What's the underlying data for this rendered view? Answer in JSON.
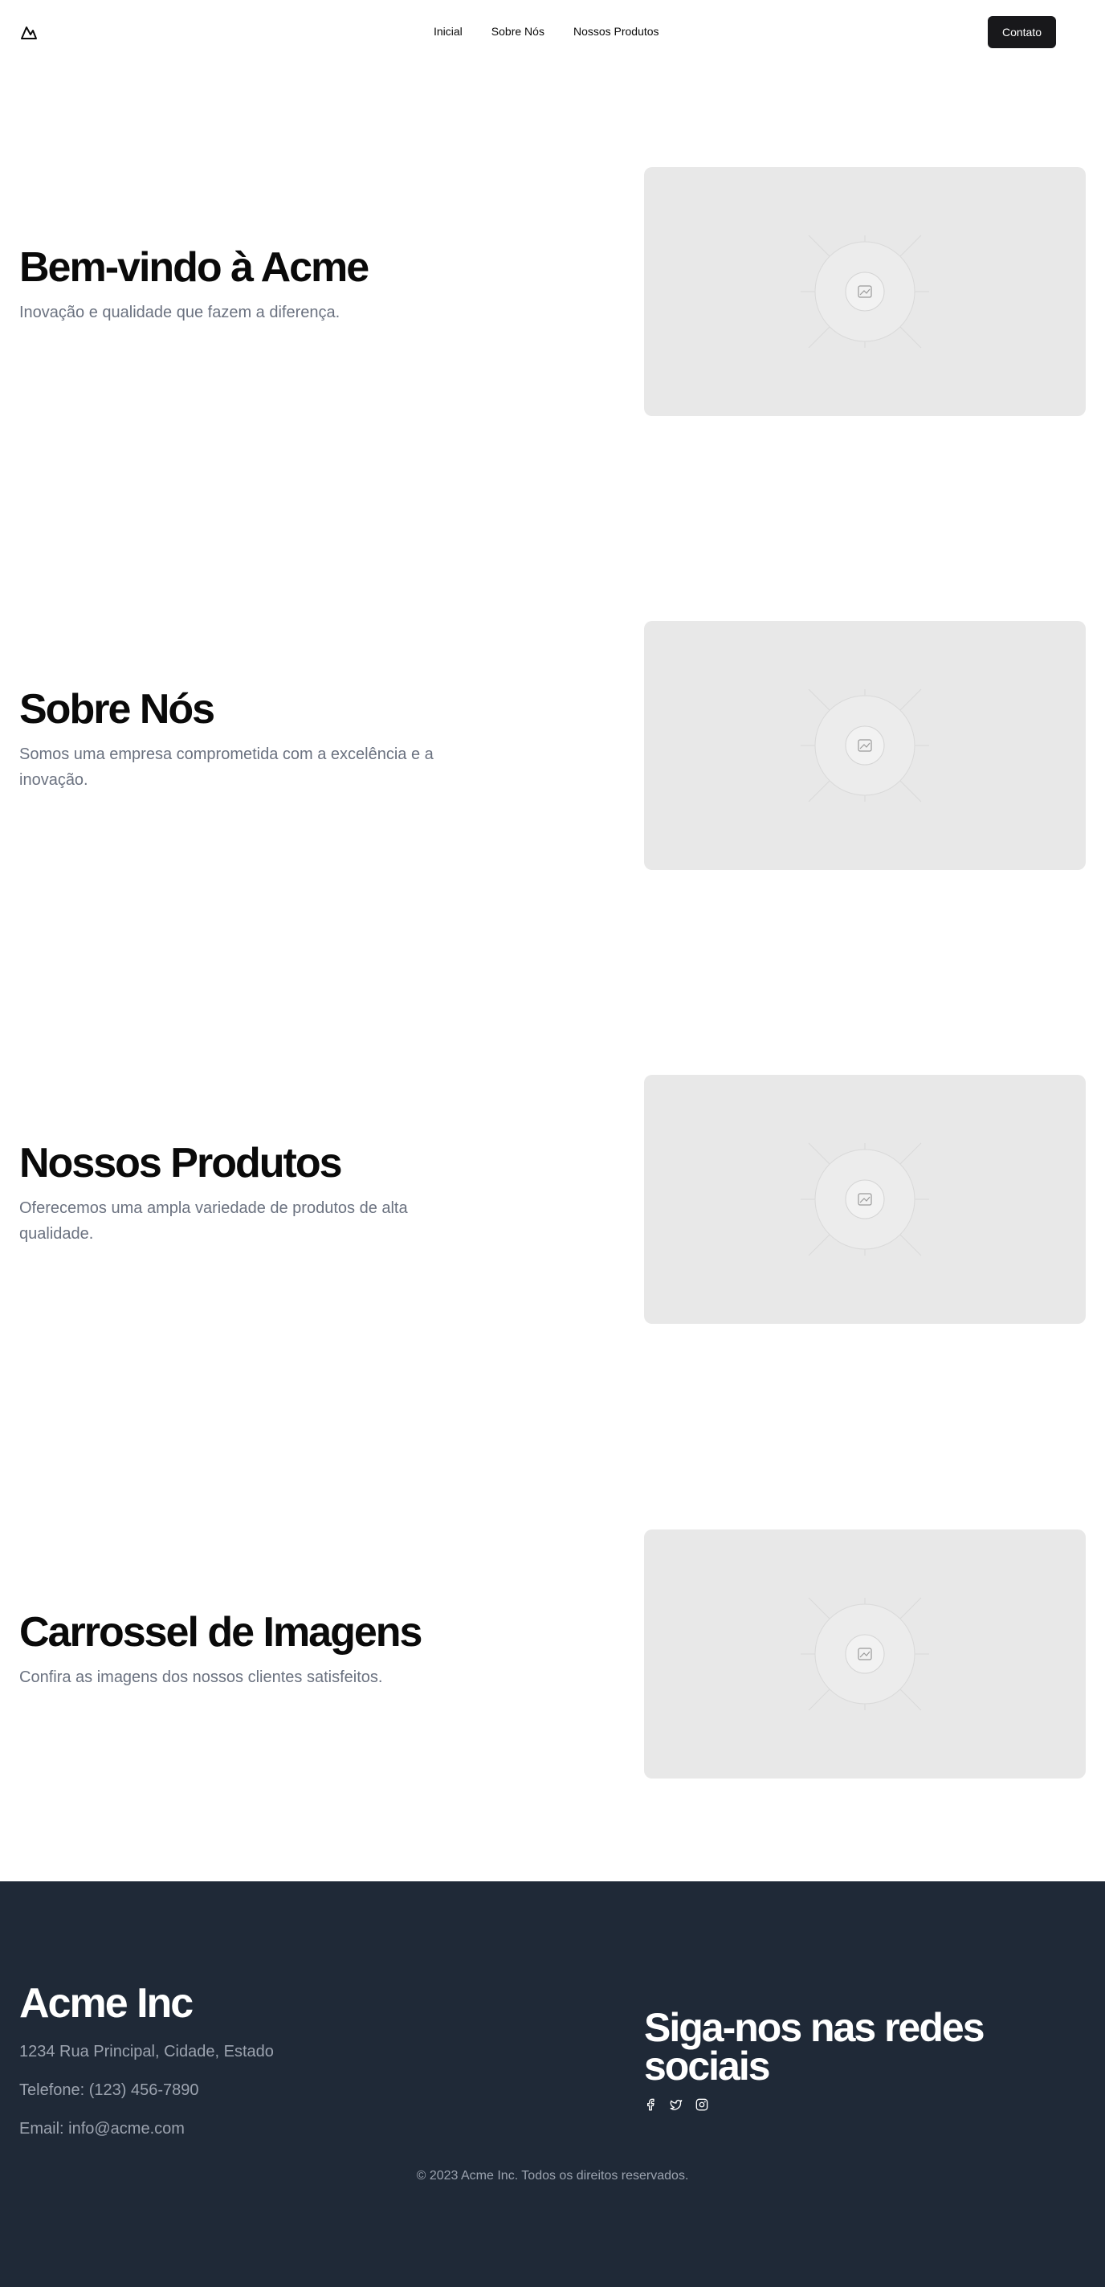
{
  "header": {
    "logo_icon": "mountain-icon",
    "nav": [
      {
        "label": "Inicial"
      },
      {
        "label": "Sobre Nós"
      },
      {
        "label": "Nossos Produtos"
      }
    ],
    "contact_button": "Contato"
  },
  "sections": [
    {
      "title": "Bem-vindo à Acme",
      "description": "Inovação e qualidade que fazem a diferença.",
      "image_icon": "image-placeholder-icon"
    },
    {
      "title": "Sobre Nós",
      "description": "Somos uma empresa comprometida com a excelência e a inovação.",
      "image_icon": "image-placeholder-icon"
    },
    {
      "title": "Nossos Produtos",
      "description": "Oferecemos uma ampla variedade de produtos de alta qualidade.",
      "image_icon": "image-placeholder-icon"
    },
    {
      "title": "Carrossel de Imagens",
      "description": "Confira as imagens dos nossos clientes satisfeitos.",
      "image_icon": "image-placeholder-icon"
    }
  ],
  "footer": {
    "company_name": "Acme Inc",
    "address": "1234 Rua Principal, Cidade, Estado",
    "phone": "Telefone: (123) 456-7890",
    "email": "Email: info@acme.com",
    "social_title": "Siga-nos nas redes sociais",
    "social_icons": [
      "facebook-icon",
      "twitter-icon",
      "instagram-icon"
    ],
    "copyright": "© 2023 Acme Inc. Todos os direitos reservados."
  },
  "colors": {
    "footer_bg": "#1f2937",
    "button_bg": "#18181b",
    "muted_text": "#6b7280",
    "placeholder_bg": "#e8e8e8"
  }
}
